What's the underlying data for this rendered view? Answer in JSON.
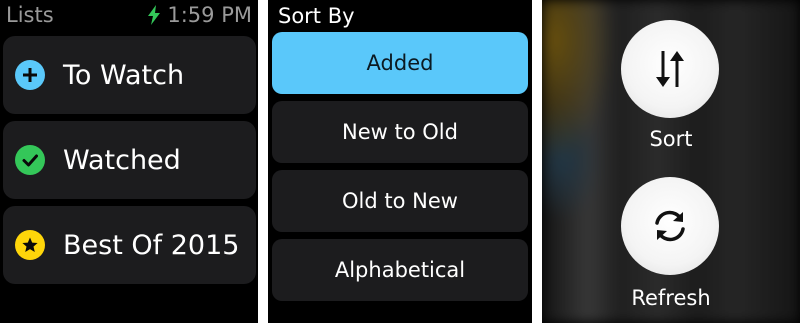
{
  "lists_screen": {
    "title": "Lists",
    "time": "1:59 PM",
    "charging_icon": "bolt-icon",
    "items": [
      {
        "label": "To Watch",
        "icon": "plus-icon",
        "color": "#5ac8fa"
      },
      {
        "label": "Watched",
        "icon": "checkmark-icon",
        "color": "#34c759"
      },
      {
        "label": "Best Of 2015",
        "icon": "star-icon",
        "color": "#ffd60a"
      }
    ]
  },
  "sort_screen": {
    "title": "Sort By",
    "options": [
      {
        "label": "Added",
        "selected": true
      },
      {
        "label": "New to Old",
        "selected": false
      },
      {
        "label": "Old to New",
        "selected": false
      },
      {
        "label": "Alphabetical",
        "selected": false
      }
    ],
    "accent_color": "#5ac8fa"
  },
  "menu_screen": {
    "actions": [
      {
        "label": "Sort",
        "icon": "sort-arrows-icon"
      },
      {
        "label": "Refresh",
        "icon": "refresh-icon"
      }
    ]
  }
}
